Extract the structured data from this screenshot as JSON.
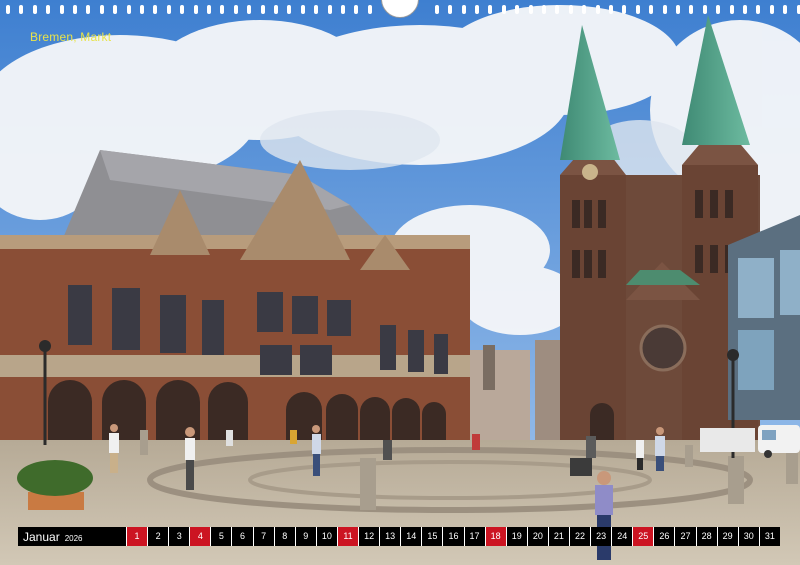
{
  "caption": "Bremen, Markt",
  "calendar": {
    "month": "Januar",
    "year": "2026",
    "days": [
      {
        "n": "1",
        "red": true
      },
      {
        "n": "2",
        "red": false
      },
      {
        "n": "3",
        "red": false
      },
      {
        "n": "4",
        "red": true
      },
      {
        "n": "5",
        "red": false
      },
      {
        "n": "6",
        "red": false
      },
      {
        "n": "7",
        "red": false
      },
      {
        "n": "8",
        "red": false
      },
      {
        "n": "9",
        "red": false
      },
      {
        "n": "10",
        "red": false
      },
      {
        "n": "11",
        "red": true
      },
      {
        "n": "12",
        "red": false
      },
      {
        "n": "13",
        "red": false
      },
      {
        "n": "14",
        "red": false
      },
      {
        "n": "15",
        "red": false
      },
      {
        "n": "16",
        "red": false
      },
      {
        "n": "17",
        "red": false
      },
      {
        "n": "18",
        "red": true
      },
      {
        "n": "19",
        "red": false
      },
      {
        "n": "20",
        "red": false
      },
      {
        "n": "21",
        "red": false
      },
      {
        "n": "22",
        "red": false
      },
      {
        "n": "23",
        "red": false
      },
      {
        "n": "24",
        "red": false
      },
      {
        "n": "25",
        "red": true
      },
      {
        "n": "26",
        "red": false
      },
      {
        "n": "27",
        "red": false
      },
      {
        "n": "28",
        "red": false
      },
      {
        "n": "29",
        "red": false
      },
      {
        "n": "30",
        "red": false
      },
      {
        "n": "31",
        "red": false
      }
    ]
  },
  "colors": {
    "holiday": "#cc1422",
    "cell": "#000000",
    "caption": "#e8e34a"
  }
}
